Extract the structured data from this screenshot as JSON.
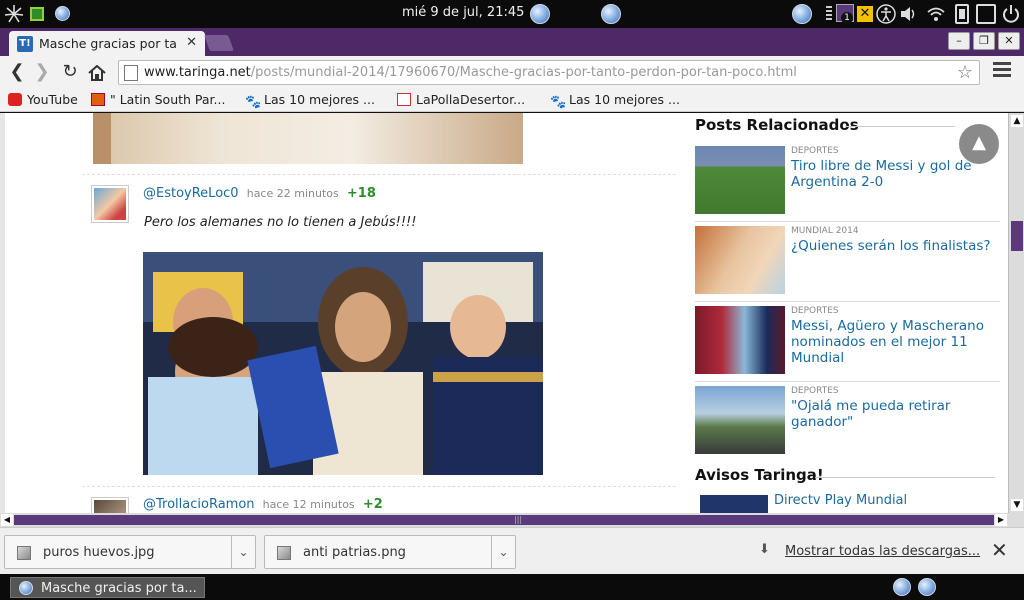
{
  "system": {
    "clock": "mié  9 de jul, 21:45",
    "badge_count": "1"
  },
  "browser": {
    "tab_title": "Masche gracias por ta",
    "tab_favicon": "T!",
    "url_host": "www.taringa.net",
    "url_path": "/posts/mundial-2014/17960670/Masche-gracias-por-tanto-perdon-por-tan-poco.html",
    "bookmarks": [
      {
        "label": "YouTube",
        "icon": "youtube-icon"
      },
      {
        "label": "\" Latin South Par...",
        "icon": "bookmark-icon"
      },
      {
        "label": "Las 10 mejores ...",
        "icon": "paw-icon"
      },
      {
        "label": "LaPollaDesertor...",
        "icon": "bookmark-icon"
      },
      {
        "label": "Las 10 mejores ...",
        "icon": "paw-icon"
      }
    ]
  },
  "comments": [
    {
      "user": "@EstoyReLoc0",
      "time": "hace 22 minutos",
      "score": "+18",
      "text": "Pero los alemanes no lo tienen a Jebús!!!!"
    },
    {
      "user": "@TrollacioRamon",
      "time": "hace 12 minutos",
      "score": "+2"
    }
  ],
  "sidebar": {
    "related_heading": "Posts Relacionados",
    "related": [
      {
        "category": "DEPORTES",
        "title": "Tiro libre de Messi y gol de Argentina 2-0"
      },
      {
        "category": "MUNDIAL 2014",
        "title": "¿Quienes serán los finalistas?"
      },
      {
        "category": "DEPORTES",
        "title": "Messi, Agüero y Mascherano nominados en el mejor 11 Mundial"
      },
      {
        "category": "DEPORTES",
        "title": "\"Ojalá me pueda retirar ganador\""
      }
    ],
    "avisos_heading": "Avisos Taringa!",
    "aviso_title": "Directv Play Mundial"
  },
  "downloads": {
    "items": [
      {
        "name": "puros huevos.jpg"
      },
      {
        "name": "anti patrias.png"
      }
    ],
    "show_all": "Mostrar todas las descargas..."
  },
  "taskbar": {
    "window_label": "Masche gracias por ta..."
  },
  "colors": {
    "chrome_accent": "#4d2a67",
    "link": "#1a6aa0",
    "score": "#2e8b2e"
  }
}
